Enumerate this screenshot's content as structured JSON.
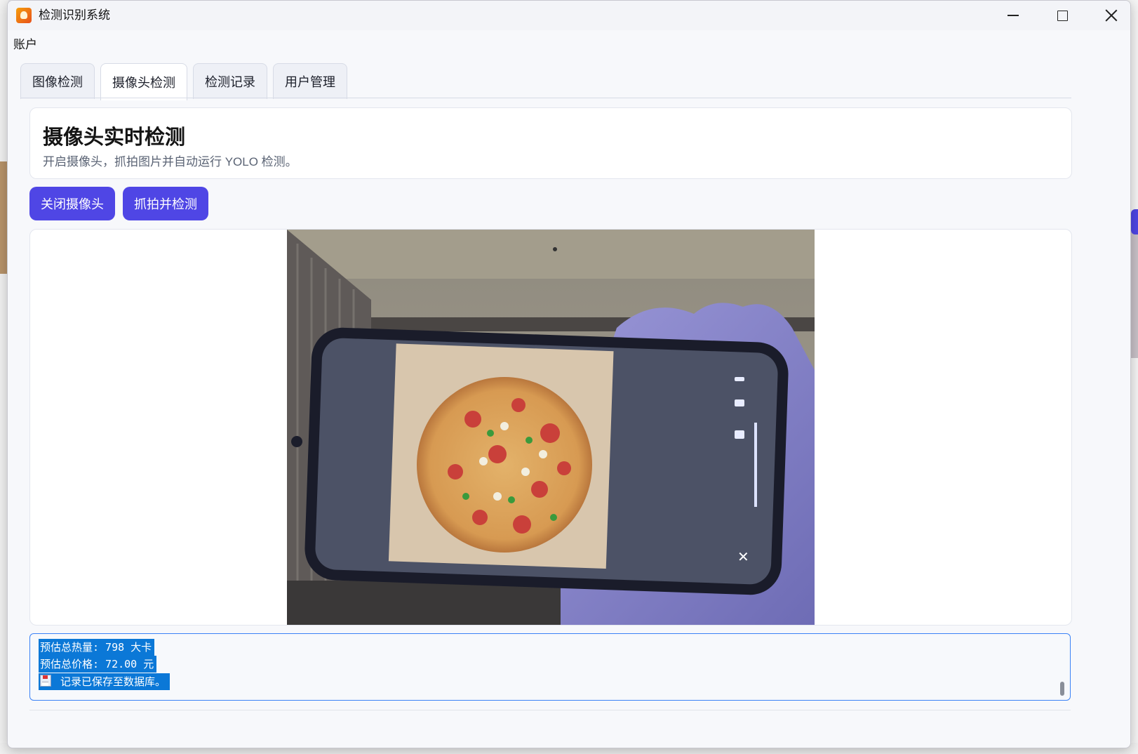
{
  "window": {
    "title": "检测识别系统"
  },
  "menubar": {
    "account": "账户"
  },
  "tabs": [
    {
      "label": "图像检测",
      "active": false
    },
    {
      "label": "摄像头检测",
      "active": true
    },
    {
      "label": "检测记录",
      "active": false
    },
    {
      "label": "用户管理",
      "active": false
    }
  ],
  "header": {
    "title": "摄像头实时检测",
    "subtitle": "开启摄像头，抓拍图片并自动运行 YOLO 检测。"
  },
  "actions": {
    "close_camera": "关闭摄像头",
    "snapshot_detect": "抓拍并检测"
  },
  "log": {
    "lines": [
      "预估总热量: 798 大卡",
      "预估总价格: 72.00 元",
      "记录已保存至数据库。"
    ],
    "line3_icon": "floppy-disk-icon"
  },
  "colors": {
    "accent": "#4f46e5",
    "selection": "#0b78d7",
    "focus_border": "#3b82f6"
  }
}
